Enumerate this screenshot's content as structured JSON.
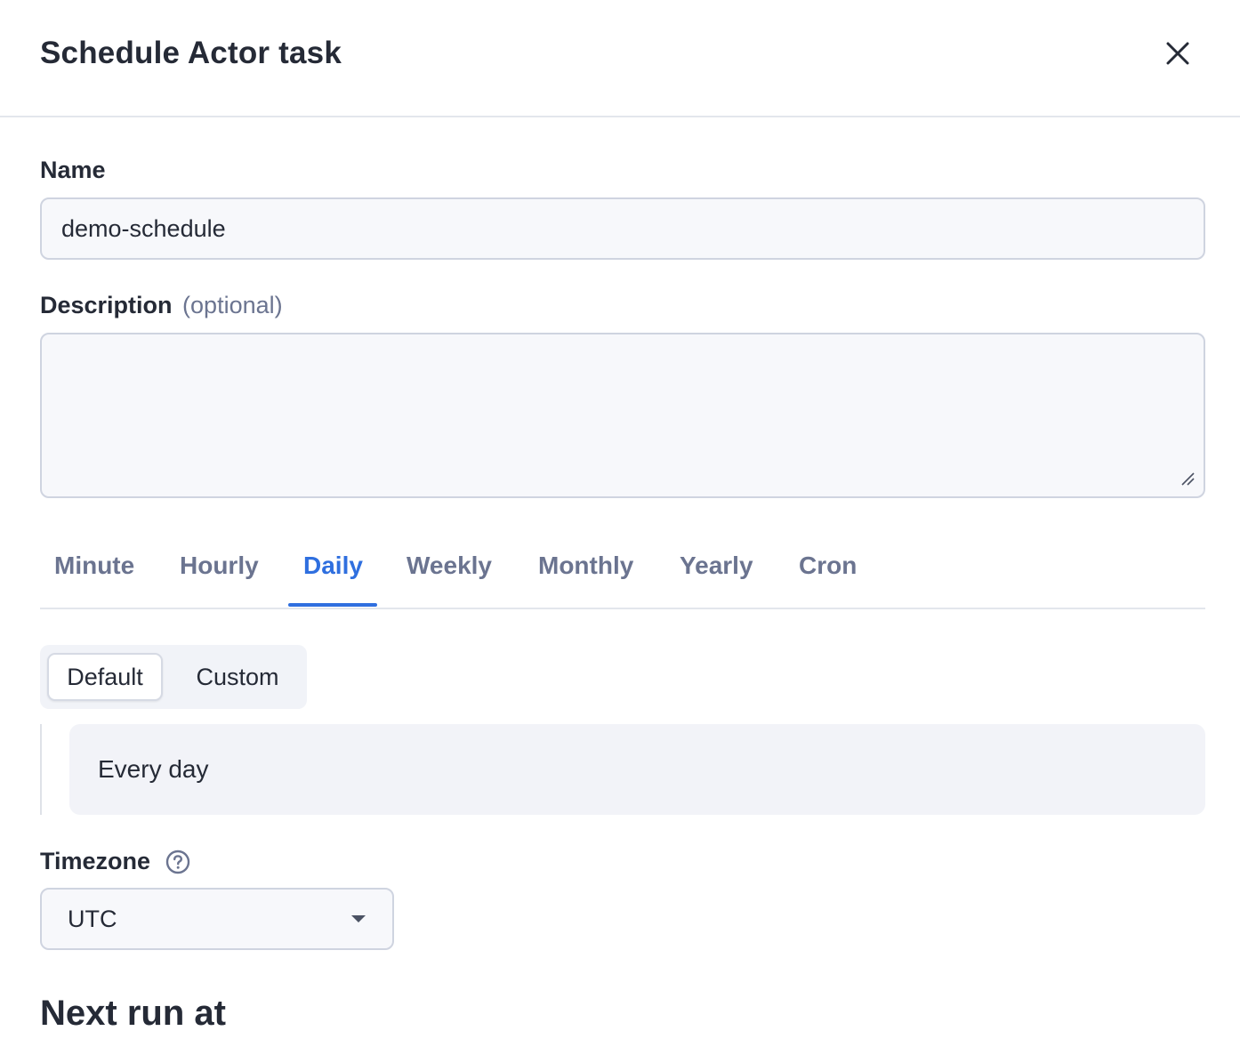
{
  "dialog": {
    "title": "Schedule Actor task",
    "close_icon": "close-icon"
  },
  "name_field": {
    "label": "Name",
    "value": "demo-schedule"
  },
  "description_field": {
    "label": "Description",
    "optional_text": "(optional)",
    "value": ""
  },
  "frequency_tabs": {
    "items": [
      {
        "label": "Minute"
      },
      {
        "label": "Hourly"
      },
      {
        "label": "Daily"
      },
      {
        "label": "Weekly"
      },
      {
        "label": "Monthly"
      },
      {
        "label": "Yearly"
      },
      {
        "label": "Cron"
      }
    ],
    "active": "Daily",
    "accent_color": "#2f6fdf"
  },
  "mode_toggle": {
    "options": [
      {
        "label": "Default"
      },
      {
        "label": "Custom"
      }
    ],
    "selected": "Default"
  },
  "schedule_summary": {
    "text": "Every day"
  },
  "timezone": {
    "label": "Timezone",
    "help_icon": "question-circle-icon",
    "selected": "UTC",
    "dropdown_icon": "caret-down-icon"
  },
  "next_run": {
    "heading": "Next run at"
  }
}
